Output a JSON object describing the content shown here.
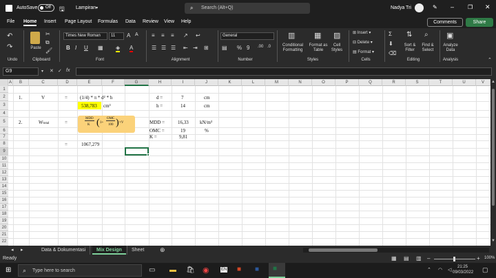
{
  "titlebar": {
    "autosave_label": "AutoSave",
    "autosave_state": "Off",
    "filename": "Lampiran",
    "search_placeholder": "Search (Alt+Q)",
    "user_name": "Nadya Tri"
  },
  "tabs": [
    "File",
    "Home",
    "Insert",
    "Page Layout",
    "Formulas",
    "Data",
    "Review",
    "View",
    "Help"
  ],
  "active_tab": "Home",
  "ribbon": {
    "comments_label": "Comments",
    "share_label": "Share",
    "font_name": "Times New Roman",
    "font_size": "11",
    "number_format": "General",
    "paste_label": "Paste",
    "undo_group": "Undo",
    "clipboard_group": "Clipboard",
    "font_group": "Font",
    "alignment_group": "Alignment",
    "number_group": "Number",
    "styles_group": "Styles",
    "cells_group": "Cells",
    "editing_group": "Editing",
    "analysis_group": "Analysis",
    "conditional_formatting": "Conditional Formatting",
    "format_as_table": "Format as Table",
    "cell_styles": "Cell Styles",
    "insert": "Insert",
    "delete": "Delete",
    "format": "Format",
    "sort_filter": "Sort & Filter",
    "find_select": "Find & Select",
    "analyze_data": "Analyze Data",
    "bold": "B",
    "italic": "I",
    "underline": "U",
    "percent": "%"
  },
  "formula_bar": {
    "name_box": "G9",
    "fx": "fx",
    "formula": ""
  },
  "columns": [
    "A",
    "B",
    "C",
    "D",
    "E",
    "F",
    "G",
    "H",
    "I",
    "J",
    "K",
    "L",
    "M",
    "N",
    "O",
    "P",
    "Q",
    "R",
    "S",
    "T",
    "U",
    "V"
  ],
  "rows": [
    "1",
    "2",
    "3",
    "4",
    "5",
    "6",
    "7",
    "8",
    "9",
    "10",
    "11",
    "12",
    "13",
    "14",
    "15",
    "16",
    "17",
    "18",
    "19",
    "20",
    "21",
    "22"
  ],
  "cells": {
    "b2": "1.",
    "c2": "V",
    "d2": "=",
    "e2": "(1/4) * π * d² * h",
    "h2": "d =",
    "i2": "7",
    "j2": "cm",
    "e3_value": "538,783",
    "e3_unit": "cm³",
    "h3": "h =",
    "i3": "14",
    "j3": "cm",
    "b5": "2.",
    "c5": "W",
    "c5_sub": "total",
    "d5": "=",
    "formula_num": "MDD",
    "formula_den": "K",
    "formula_inner_num": "OMC",
    "formula_inner_den": "100",
    "formula_tail": "×V",
    "formula_one": "1+",
    "h5": "MDD =",
    "i5": "16,33",
    "j5": "kN/m³",
    "h6": "OMC =",
    "i6": "19",
    "j6": "%",
    "h7": "K =",
    "i7": "9,81",
    "d8": "=",
    "e8": "1067,279"
  },
  "sheets": [
    "Data & Dokumentasi",
    "Mix Design",
    "Sheet"
  ],
  "active_sheet": "Mix Design",
  "status": {
    "ready": "Ready",
    "zoom": "100%"
  },
  "taskbar": {
    "search_placeholder": "Type here to search",
    "time": "21:25",
    "date": "09/03/2022"
  },
  "colors": {
    "highlight": "#ffff00",
    "formula_box": "#fbd27a",
    "share_green": "#2f7a46",
    "selection_green": "#217346"
  }
}
